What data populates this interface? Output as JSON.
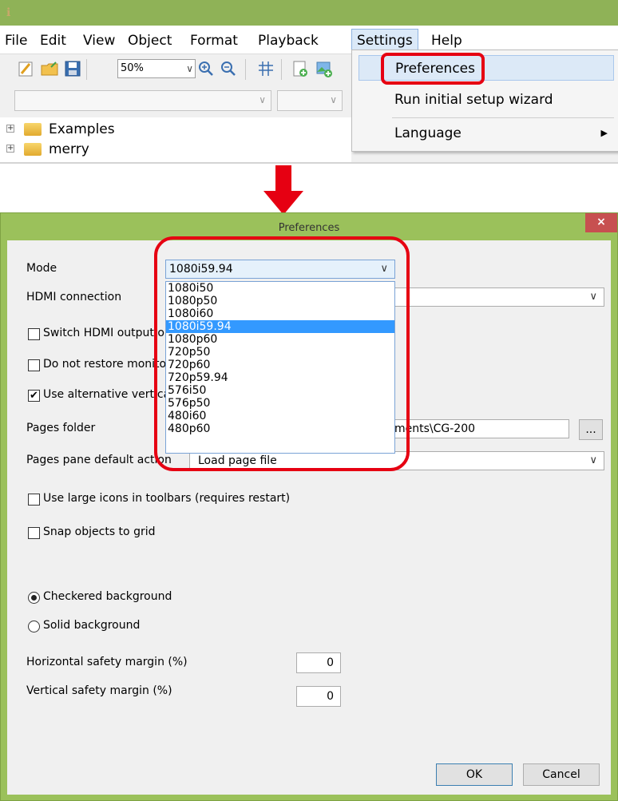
{
  "app": {
    "menus": [
      "File",
      "Edit",
      "View",
      "Object",
      "Format",
      "Playback",
      "Settings",
      "Help"
    ],
    "zoom": "50%",
    "tree": [
      "Examples",
      "merry"
    ],
    "settings_menu": {
      "preferences": "Preferences",
      "wizard": "Run initial setup wizard",
      "language": "Language"
    }
  },
  "dialog": {
    "title": "Preferences",
    "close": "×",
    "mode_label": "Mode",
    "mode_value": "1080i59.94",
    "mode_options": [
      "1080i50",
      "1080p50",
      "1080i60",
      "1080i59.94",
      "1080p60",
      "720p50",
      "720p60",
      "720p59.94",
      "576i50",
      "576p50",
      "480i60",
      "480p60"
    ],
    "mode_selected_index": 3,
    "hdmi_label": "HDMI connection",
    "switch_hdmi_label": "Switch HDMI output on",
    "no_restore_label": "Do not restore monitor",
    "alt_vertical_label": "Use alternative vertical",
    "alt_vertical_checked": true,
    "pages_folder_label": "Pages folder",
    "pages_folder_value": "ments\\CG-200",
    "browse_label": "...",
    "pages_action_label": "Pages pane default action",
    "pages_action_value": "Load page file",
    "large_icons_label": "Use large icons in toolbars (requires restart)",
    "snap_label": "Snap objects to grid",
    "checkered_label": "Checkered background",
    "solid_label": "Solid background",
    "h_margin_label": "Horizontal safety margin (%)",
    "h_margin_value": "0",
    "v_margin_label": "Vertical safety margin (%)",
    "v_margin_value": "0",
    "ok_label": "OK",
    "cancel_label": "Cancel"
  },
  "colors": {
    "highlight": "#e60012",
    "titlebar": "#8fb257",
    "selection": "#3399ff"
  }
}
